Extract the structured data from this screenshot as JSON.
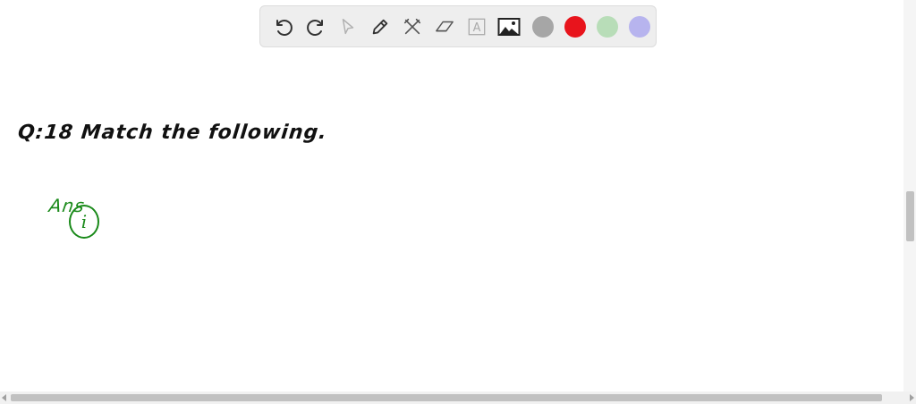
{
  "toolbar": {
    "tools": [
      {
        "name": "undo-icon",
        "enabled": true
      },
      {
        "name": "redo-icon",
        "enabled": true
      },
      {
        "name": "select-pointer-icon",
        "enabled": false
      },
      {
        "name": "pencil-icon",
        "enabled": true
      },
      {
        "name": "tools-icon",
        "enabled": true
      },
      {
        "name": "eraser-icon",
        "enabled": true
      },
      {
        "name": "text-icon",
        "enabled": false
      },
      {
        "name": "image-icon",
        "enabled": true
      }
    ],
    "colors": [
      "#a6a6a6",
      "#e8141c",
      "#b8ddb8",
      "#b7b4ee"
    ],
    "text_icon_glyph": "A"
  },
  "canvas": {
    "question": "Q:18  Match  the  following.",
    "answer_label": "Ans",
    "item_marker": "i",
    "colors": {
      "question": "#111111",
      "answer": "#1a8a1a"
    }
  }
}
